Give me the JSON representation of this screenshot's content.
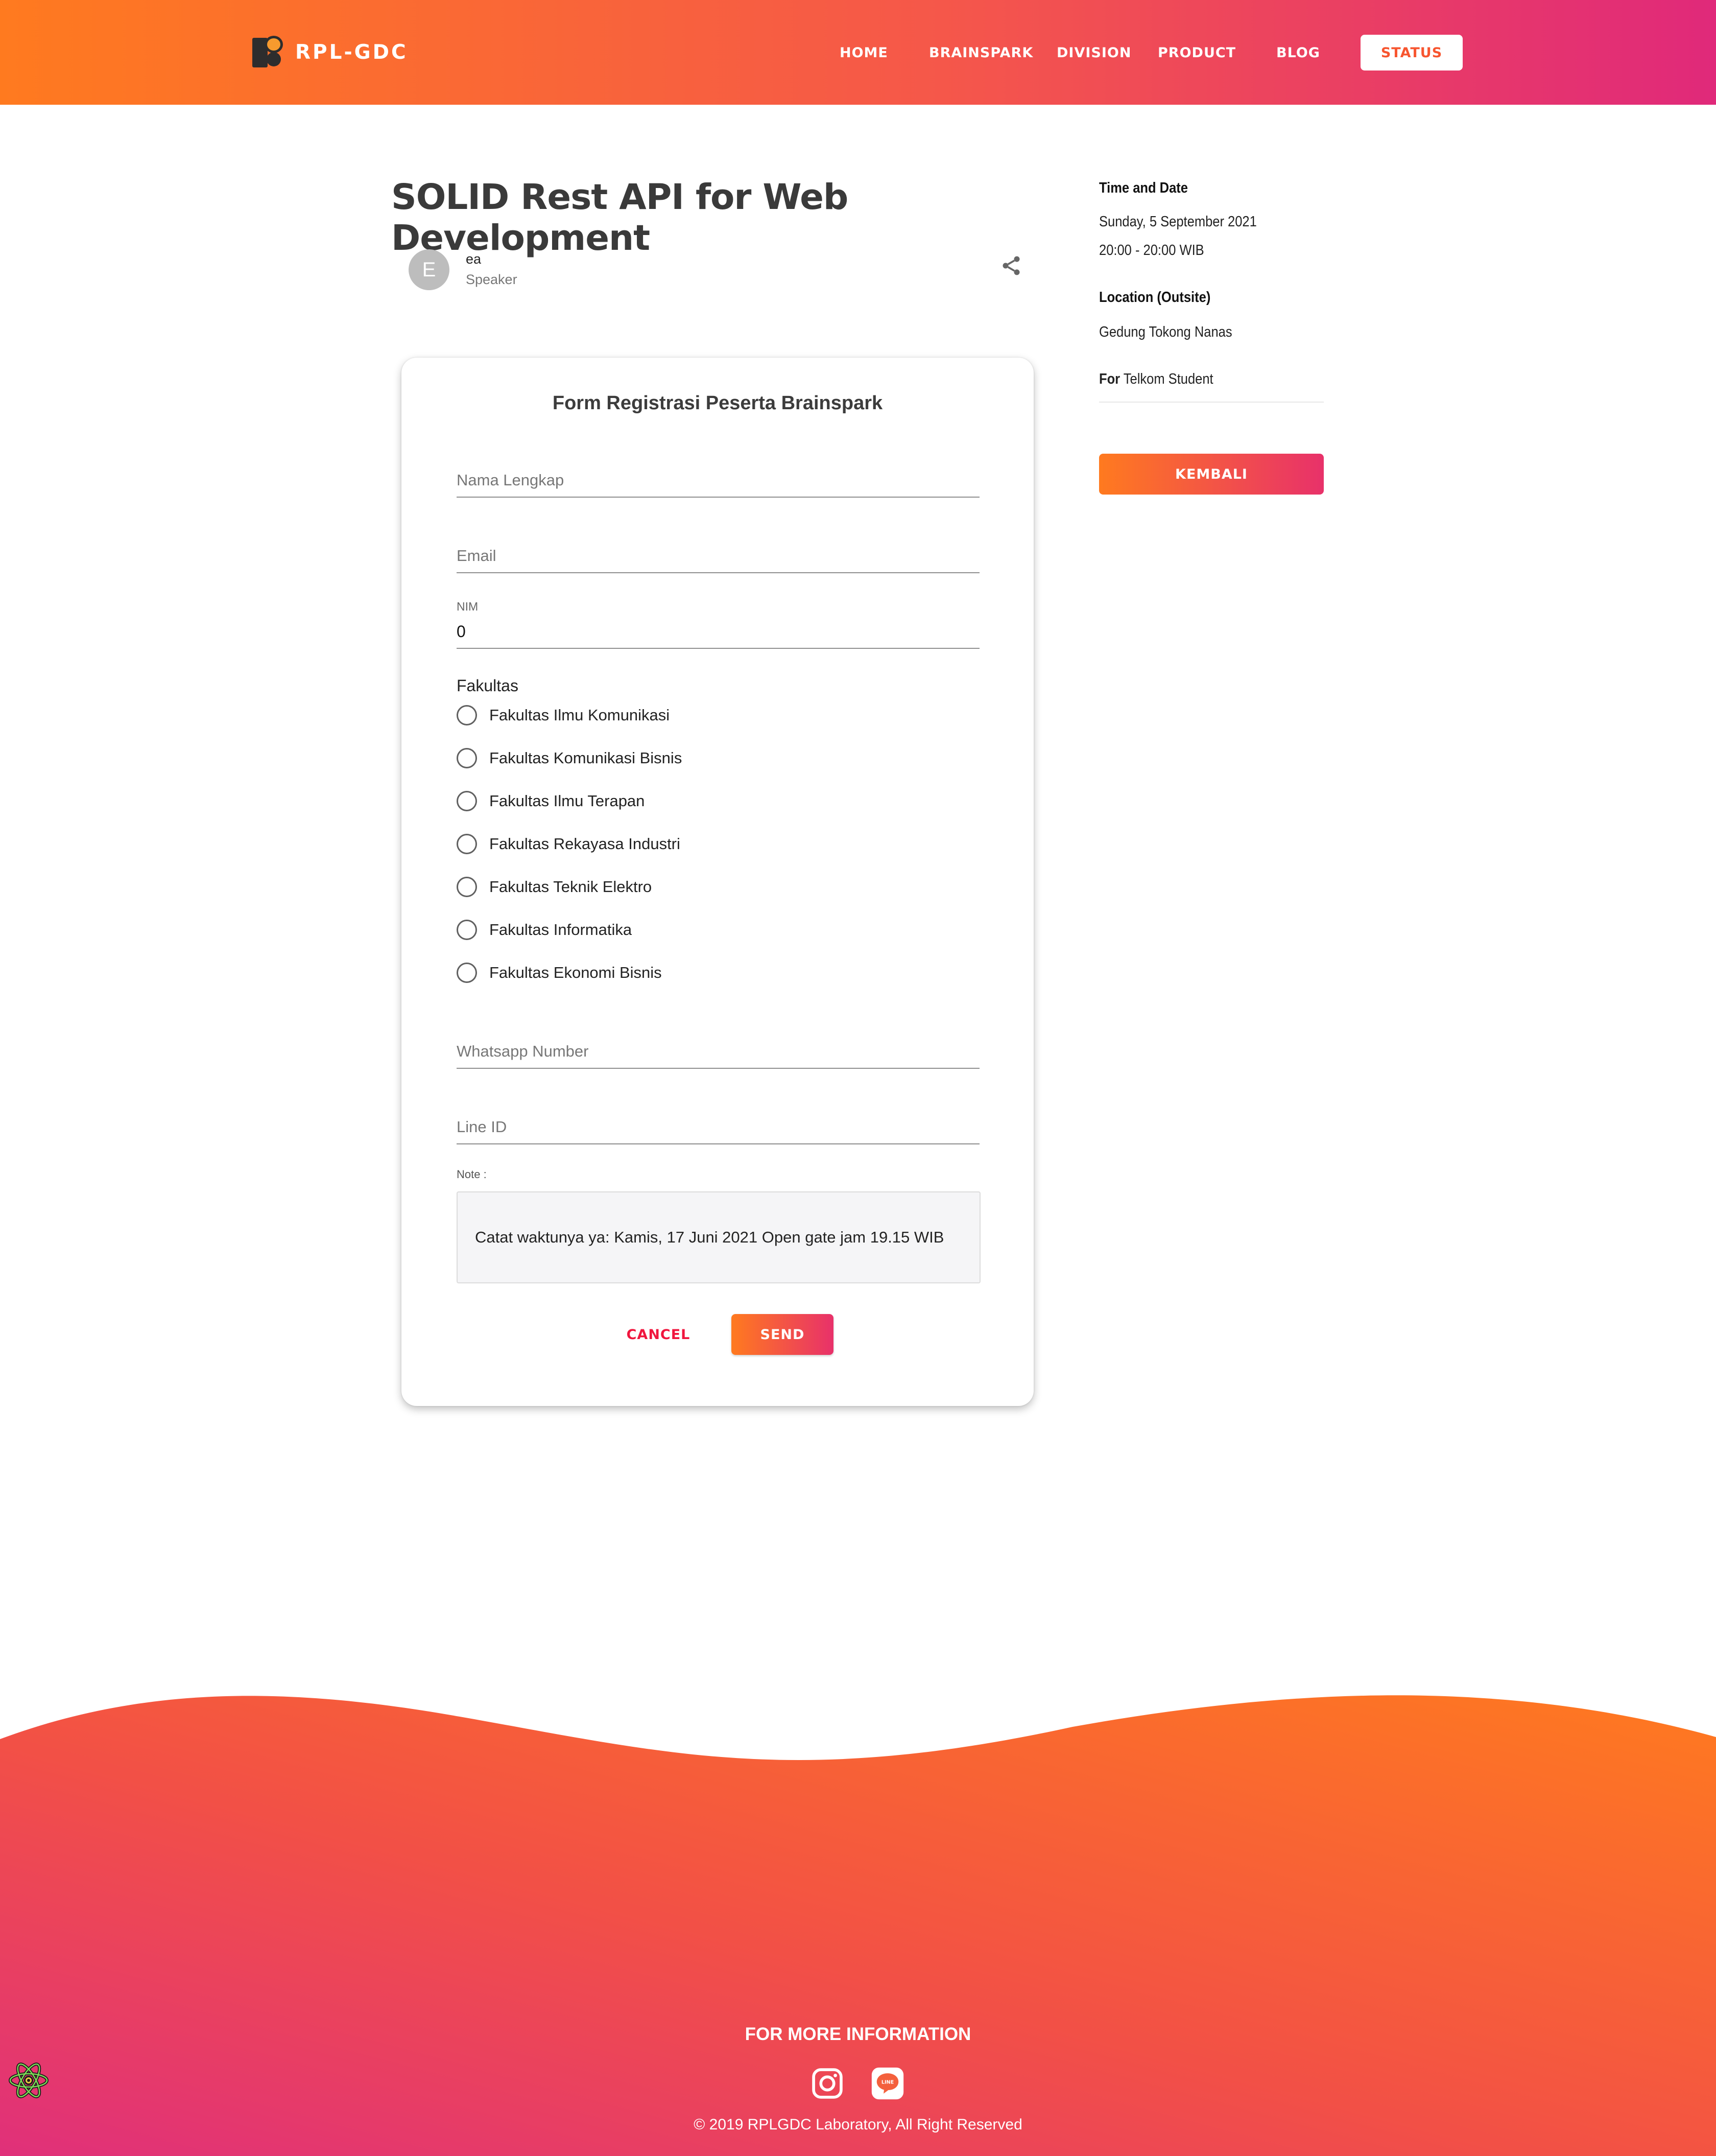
{
  "brand": {
    "name": "RPL-GDC"
  },
  "nav": {
    "items": [
      "HOME",
      "BRAINSPARK",
      "DIVISION",
      "PRODUCT",
      "BLOG"
    ],
    "status_label": "STATUS"
  },
  "event": {
    "title": "SOLID Rest API for Web Development",
    "speaker_initial": "E",
    "speaker_name": "ea",
    "speaker_role": "Speaker"
  },
  "form": {
    "title": "Form Registrasi Peserta Brainspark",
    "name_placeholder": "Nama Lengkap",
    "email_placeholder": "Email",
    "nim_label": "NIM",
    "nim_value": "0",
    "fakultas_label": "Fakultas",
    "fakultas_options": [
      "Fakultas Ilmu Komunikasi",
      "Fakultas Komunikasi Bisnis",
      "Fakultas Ilmu Terapan",
      "Fakultas Rekayasa Industri",
      "Fakultas Teknik Elektro",
      "Fakultas Informatika",
      "Fakultas Ekonomi Bisnis"
    ],
    "whatsapp_placeholder": "Whatsapp Number",
    "line_placeholder": "Line ID",
    "note_label": "Note :",
    "note_text": "Catat waktunya ya: Kamis, 17 Juni 2021 Open gate jam 19.15 WIB",
    "cancel_label": "CANCEL",
    "send_label": "SEND"
  },
  "sidebar": {
    "time_heading": "Time and Date",
    "date": "Sunday, 5 September 2021",
    "time": "20:00 - 20:00 WIB",
    "location_heading": "Location (Outsite)",
    "location": "Gedung Tokong Nanas",
    "for_label": "For",
    "for_value": "Telkom Student",
    "back_label": "KEMBALI"
  },
  "footer": {
    "title": "FOR MORE INFORMATION",
    "line_icon_text": "LINE",
    "copyright": "© 2019 RPLGDC Laboratory, All Right Reserved"
  },
  "colors": {
    "gradient_start": "#ff7a1f",
    "gradient_end": "#e0297a",
    "cancel": "#f0163e"
  },
  "icons": [
    "share-icon",
    "instagram-icon",
    "line-icon",
    "react-icon"
  ]
}
